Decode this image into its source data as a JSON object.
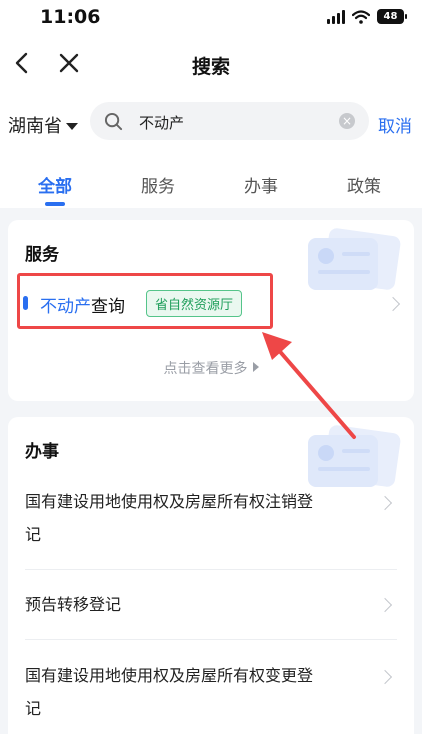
{
  "status_bar": {
    "time": "11:06",
    "battery": "48"
  },
  "nav": {
    "title": "搜索"
  },
  "search": {
    "region": "湖南省",
    "query": "不动产",
    "cancel": "取消"
  },
  "tabs": [
    {
      "label": "全部",
      "active": true
    },
    {
      "label": "服务",
      "active": false
    },
    {
      "label": "办事",
      "active": false
    },
    {
      "label": "政策",
      "active": false
    }
  ],
  "services": {
    "title": "服务",
    "item": {
      "name_highlight": "不动产",
      "name_rest": "查询",
      "tag": "省自然资源厅"
    },
    "more": "点击查看更多"
  },
  "affairs": {
    "title": "办事",
    "items": [
      {
        "line1": "国有建设用地使用权及房屋所有权注销登",
        "line2": "记"
      },
      {
        "line1": "预告转移登记",
        "line2": ""
      },
      {
        "line1": "国有建设用地使用权及房屋所有权变更登",
        "line2": "记"
      }
    ]
  },
  "colors": {
    "accent": "#2a6ff0",
    "annotation": "#ee4747",
    "tag_green": "#1e9e5a"
  }
}
